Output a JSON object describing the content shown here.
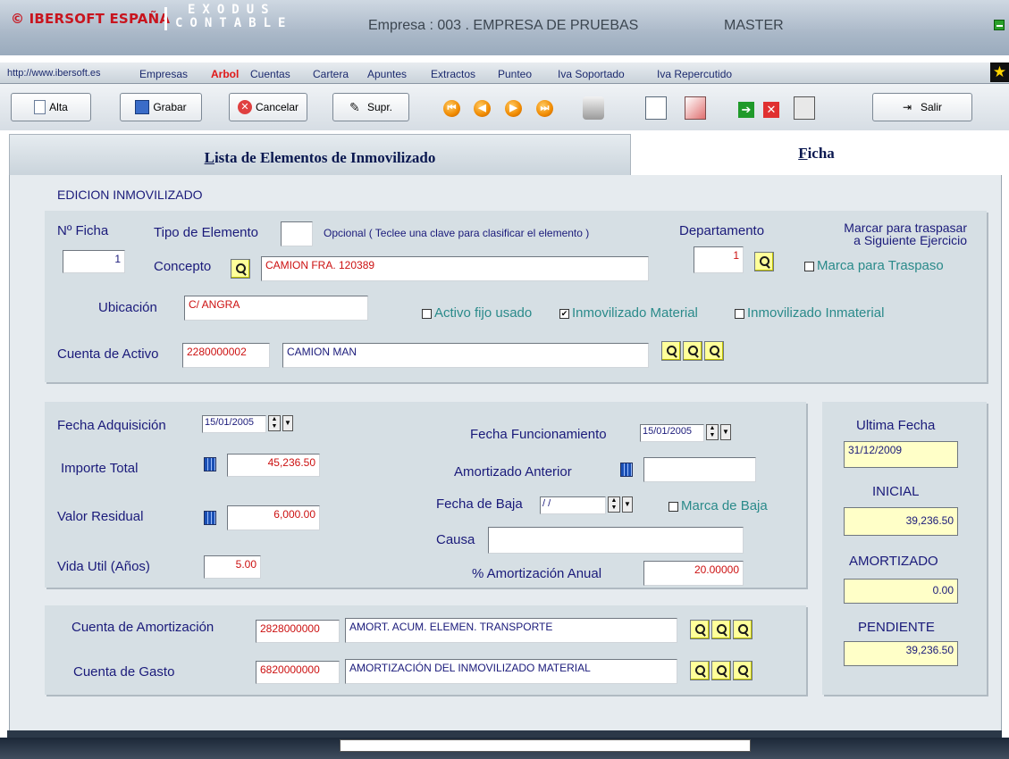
{
  "header": {
    "brand": "© IBERSOFT ESPAÑA",
    "logo_line1": "EXODUS",
    "logo_line2": "CONTABLE",
    "empresa": "Empresa : 003 . EMPRESA DE PRUEBAS",
    "user": "MASTER"
  },
  "menu": {
    "url": "http://www.ibersoft.es",
    "items": [
      "Empresas",
      "Arbol",
      "Cuentas",
      "Cartera",
      "Apuntes",
      "Extractos",
      "Punteo",
      "Iva Soportado",
      "Iva Repercutido"
    ],
    "active_color": "#e01818"
  },
  "toolbar": {
    "alta": "Alta",
    "grabar": "Grabar",
    "cancelar": "Cancelar",
    "suprimir": "Supr.",
    "salir": "Salir"
  },
  "tabs": {
    "lista": "Lista de Elementos de Inmovilizado",
    "ficha": "Ficha"
  },
  "form": {
    "section_title": "EDICION INMOVILIZADO",
    "nficha_label": "Nº Ficha",
    "nficha_value": "1",
    "tipo_label": "Tipo de Elemento",
    "tipo_value": "",
    "tipo_hint": "Opcional ( Teclee una clave para clasificar el elemento )",
    "departamento_label": "Departamento",
    "departamento_value": "1",
    "traspaso_title_1": "Marcar para traspasar",
    "traspaso_title_2": "a Siguiente Ejercicio",
    "traspaso_check": "Marca para Traspaso",
    "concepto_label": "Concepto",
    "concepto_value": "CAMION FRA. 120389",
    "ubicacion_label": "Ubicación",
    "ubicacion_value": "C/ ANGRA",
    "activo_usado": "Activo fijo usado",
    "inmov_material": "Inmovilizado Material",
    "inmov_inmaterial": "Inmovilizado Inmaterial",
    "cuenta_activo_label": "Cuenta de Activo",
    "cuenta_activo_code": "2280000002",
    "cuenta_activo_name": "CAMION MAN",
    "fecha_adq_label": "Fecha Adquisición",
    "fecha_adq_value": "15/01/2005",
    "fecha_func_label": "Fecha Funcionamiento",
    "fecha_func_value": "15/01/2005",
    "importe_label": "Importe Total",
    "importe_value": "45,236.50",
    "amort_ant_label": "Amortizado Anterior",
    "amort_ant_value": "",
    "fecha_baja_label": "Fecha de Baja",
    "fecha_baja_value": "/ /",
    "marca_baja": "Marca de Baja",
    "residual_label": "Valor Residual",
    "residual_value": "6,000.00",
    "causa_label": "Causa",
    "causa_value": "",
    "vida_label": "Vida Util (Años)",
    "vida_value": "5.00",
    "pct_label": "% Amortización Anual",
    "pct_value": "20.00000",
    "cta_amort_label": "Cuenta de Amortización",
    "cta_amort_code": "2828000000",
    "cta_amort_name": "AMORT. ACUM. ELEMEN. TRANSPORTE",
    "cta_gasto_label": "Cuenta de Gasto",
    "cta_gasto_code": "6820000000",
    "cta_gasto_name": "AMORTIZACIÓN DEL INMOVILIZADO MATERIAL"
  },
  "summary": {
    "ultima_label": "Ultima Fecha",
    "ultima_value": "31/12/2009",
    "inicial_label": "INICIAL",
    "inicial_value": "39,236.50",
    "amortizado_label": "AMORTIZADO",
    "amortizado_value": "0.00",
    "pendiente_label": "PENDIENTE",
    "pendiente_value": "39,236.50"
  }
}
